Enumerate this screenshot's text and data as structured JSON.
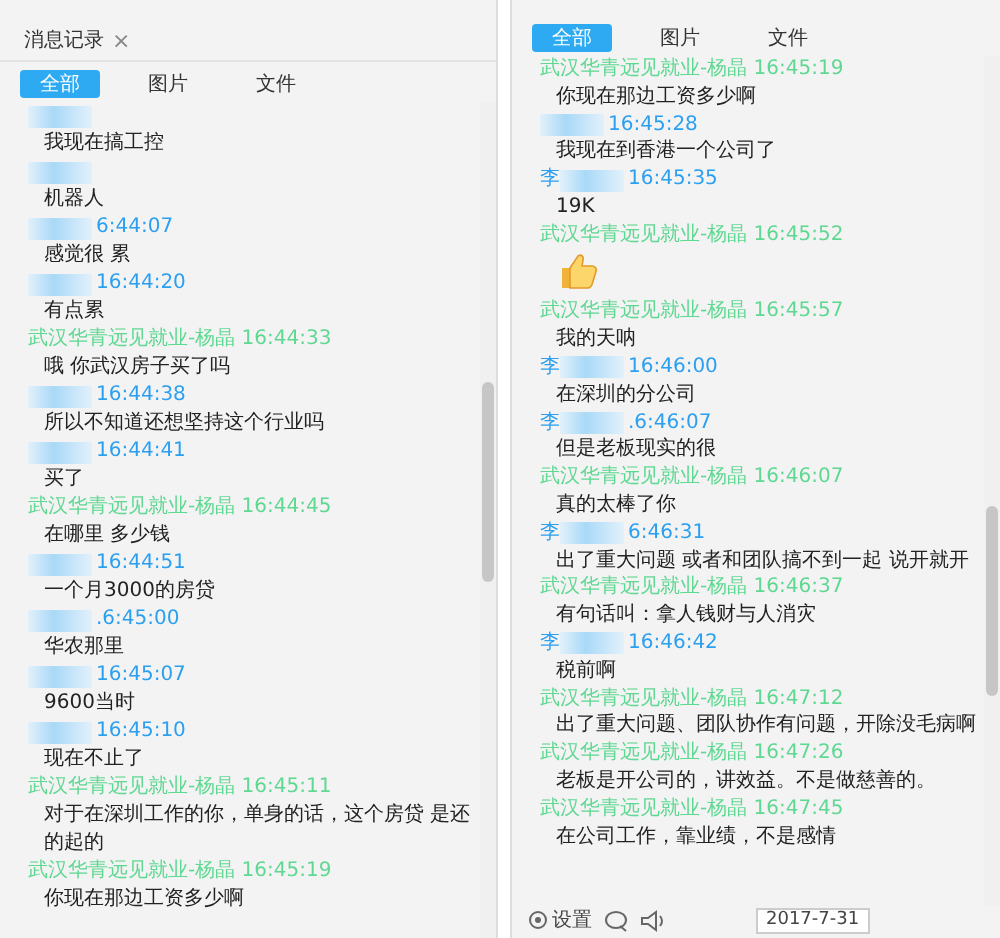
{
  "left_panel": {
    "title": "消息记录",
    "close": "×",
    "tabs": [
      {
        "label": "全部",
        "selected": true
      },
      {
        "label": "图片",
        "selected": false
      },
      {
        "label": "文件",
        "selected": false
      }
    ],
    "messages": [
      {
        "outgoing": false,
        "kind": "text",
        "text": "我现在搞工控"
      },
      {
        "outgoing": false,
        "kind": "text",
        "text": "机器人"
      },
      {
        "outgoing": false,
        "kind": "text",
        "time": "6:44:07",
        "text": "感觉很 累"
      },
      {
        "outgoing": false,
        "kind": "text",
        "time": "16:44:20",
        "text": "有点累"
      },
      {
        "outgoing": true,
        "kind": "text",
        "sender": "武汉华青远见就业-杨晶",
        "time": "16:44:33",
        "text": "哦 你武汉房子买了吗"
      },
      {
        "outgoing": false,
        "kind": "text",
        "time": "16:44:38",
        "text": "所以不知道还想坚持这个行业吗"
      },
      {
        "outgoing": false,
        "kind": "text",
        "time": "16:44:41",
        "text": "买了"
      },
      {
        "outgoing": true,
        "kind": "text",
        "sender": "武汉华青远见就业-杨晶",
        "time": "16:44:45",
        "text": "在哪里 多少钱"
      },
      {
        "outgoing": false,
        "kind": "text",
        "time": "16:44:51",
        "text": "一个月3000的房贷"
      },
      {
        "outgoing": false,
        "kind": "text",
        "time": ".6:45:00",
        "text": "华农那里"
      },
      {
        "outgoing": false,
        "kind": "text",
        "time": "16:45:07",
        "text": "9600当时"
      },
      {
        "outgoing": false,
        "kind": "text",
        "time": "16:45:10",
        "text": "现在不止了"
      },
      {
        "outgoing": true,
        "kind": "text",
        "sender": "武汉华青远见就业-杨晶",
        "time": "16:45:11",
        "text": "对于在深圳工作的你，单身的话，这个房贷 是还的起的"
      },
      {
        "outgoing": true,
        "kind": "text",
        "sender": "武汉华青远见就业-杨晶",
        "time": "16:45:19",
        "text": "你现在那边工资多少啊"
      }
    ]
  },
  "right_panel": {
    "tabs": [
      {
        "label": "全部",
        "selected": true
      },
      {
        "label": "图片",
        "selected": false
      },
      {
        "label": "文件",
        "selected": false
      }
    ],
    "messages": [
      {
        "outgoing": true,
        "kind": "text",
        "sender": "武汉华青远见就业-杨晶",
        "time": "16:45:19",
        "text": "你现在那边工资多少啊"
      },
      {
        "outgoing": false,
        "kind": "text",
        "time": "16:45:28",
        "text": "我现在到香港一个公司了"
      },
      {
        "outgoing": false,
        "kind": "text",
        "sender": "李",
        "time": "16:45:35",
        "text": "19K"
      },
      {
        "outgoing": true,
        "kind": "sticker",
        "sender": "武汉华青远见就业-杨晶",
        "time": "16:45:52"
      },
      {
        "outgoing": true,
        "kind": "text",
        "sender": "武汉华青远见就业-杨晶",
        "time": "16:45:57",
        "text": "我的天呐"
      },
      {
        "outgoing": false,
        "kind": "text",
        "sender": "李",
        "time": "16:46:00",
        "text": "在深圳的分公司"
      },
      {
        "outgoing": false,
        "kind": "text",
        "sender": "李",
        "time": ".6:46:07",
        "text": "但是老板现实的很"
      },
      {
        "outgoing": true,
        "kind": "text",
        "sender": "武汉华青远见就业-杨晶",
        "time": "16:46:07",
        "text": "真的太棒了你"
      },
      {
        "outgoing": false,
        "kind": "text",
        "sender": "李",
        "time": "6:46:31",
        "text": "出了重大问题 或者和团队搞不到一起 说开就开"
      },
      {
        "outgoing": true,
        "kind": "text",
        "sender": "武汉华青远见就业-杨晶",
        "time": "16:46:37",
        "text": "有句话叫：拿人钱财与人消灾"
      },
      {
        "outgoing": false,
        "kind": "text",
        "sender": "李",
        "time": "16:46:42",
        "text": "税前啊"
      },
      {
        "outgoing": true,
        "kind": "text",
        "sender": "武汉华青远见就业-杨晶",
        "time": "16:47:12",
        "text": "出了重大问题、团队协作有问题，开除没毛病啊"
      },
      {
        "outgoing": true,
        "kind": "text",
        "sender": "武汉华青远见就业-杨晶",
        "time": "16:47:26",
        "text": "老板是开公司的，讲效益。不是做慈善的。"
      },
      {
        "outgoing": true,
        "kind": "text",
        "sender": "武汉华青远见就业-杨晶",
        "time": "16:47:45",
        "text": "在公司工作，靠业绩，不是感情"
      }
    ],
    "toolbar": {
      "settings_label": "设置",
      "date": "2017-7-31"
    }
  }
}
